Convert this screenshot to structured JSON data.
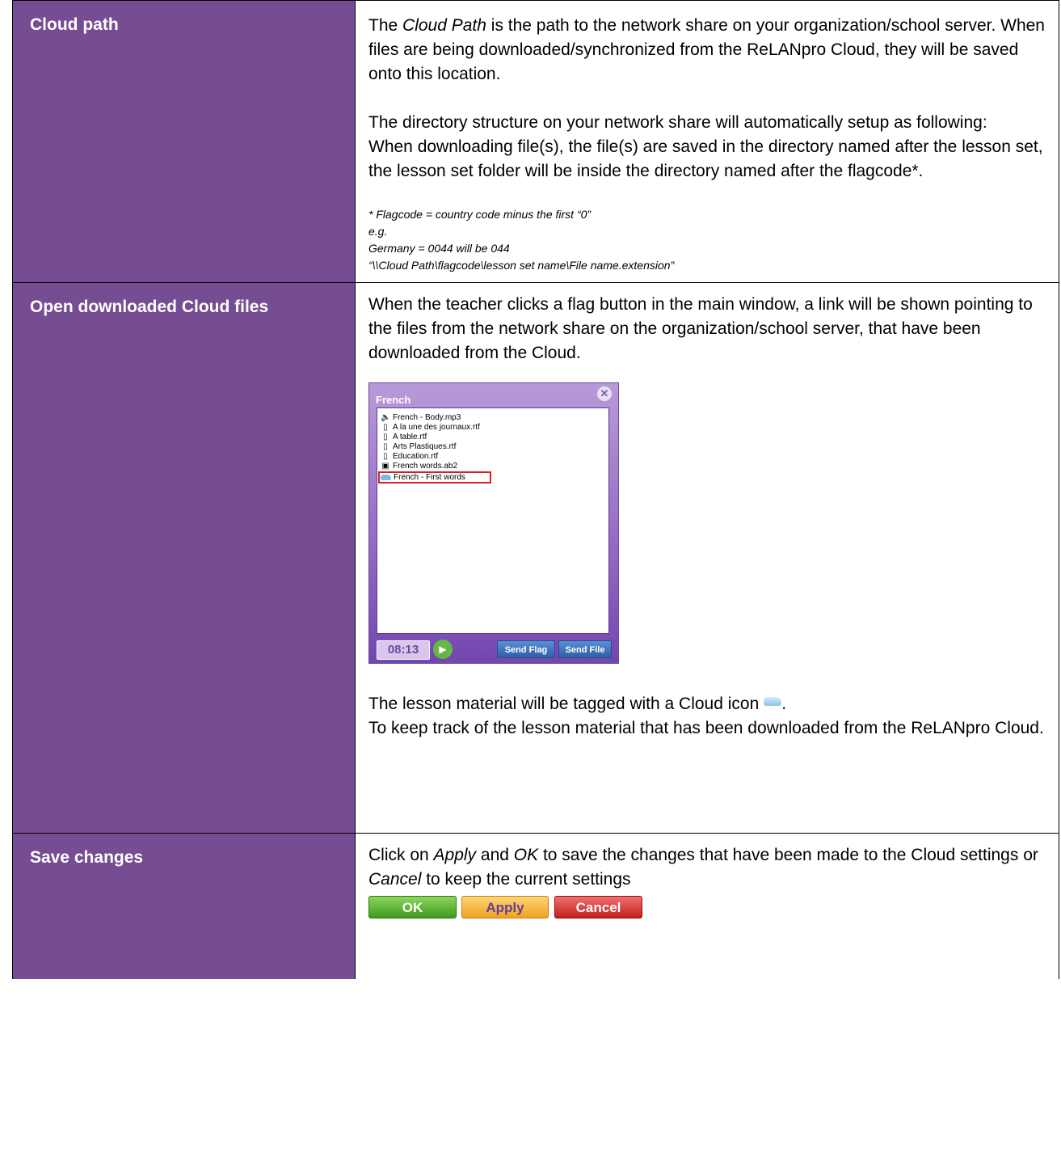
{
  "rows": [
    {
      "label": "Cloud path",
      "p1_pre": "The ",
      "p1_em": "Cloud Path",
      "p1_post": " is the path to the network share on your organization/school server. When files are being downloaded/synchronized from the ReLANpro Cloud, they will be saved onto this location.",
      "p2": "The directory structure on your network share will automatically setup as following:",
      "p3": "When downloading file(s), the file(s) are saved in the directory named after the lesson set, the lesson set folder will be inside the directory named after the flagcode*.",
      "note1": "* Flagcode = country code minus the first “0”",
      "note2": "e.g.",
      "note3": "Germany = 0044 will be 044",
      "note4": "“\\\\Cloud Path\\flagcode\\lesson set name\\File name.extension”"
    },
    {
      "label": "Open downloaded Cloud files",
      "p1": "When the teacher clicks a flag button in the main window, a link will be shown pointing to the files from the network share on the organization/school server, that have been downloaded from the Cloud.",
      "p2": "The lesson material will be tagged with a Cloud icon",
      "p2_end": ".",
      "p3": "To keep track of the lesson material that has been downloaded from the ReLANpro Cloud."
    },
    {
      "label": "Save changes",
      "p1_a": "Click on ",
      "p1_apply": "Apply",
      "p1_b": " and ",
      "p1_ok": "OK",
      "p1_c": " to save the changes that have been made to the Cloud settings or ",
      "p1_cancel": "Cancel",
      "p1_d": " to keep the current settings",
      "ok_label": "OK",
      "apply_label": "Apply",
      "cancel_label": "Cancel"
    }
  ],
  "flag_window": {
    "title": "French",
    "close_glyph": "✕",
    "files": [
      {
        "name": "French - Body.mp3",
        "icon": "speaker-icon"
      },
      {
        "name": "A la une des journaux.rtf",
        "icon": "document-icon"
      },
      {
        "name": "A table.rtf",
        "icon": "document-icon"
      },
      {
        "name": "Arts Plastiques.rtf",
        "icon": "document-icon"
      },
      {
        "name": "Education.rtf",
        "icon": "document-icon"
      },
      {
        "name": "French words.ab2",
        "icon": "ab2-file-icon"
      },
      {
        "name": "French - First words",
        "icon": "cloud-icon",
        "highlighted": true
      }
    ],
    "timer": "08:13",
    "send_flag": "Send Flag",
    "send_file": "Send File"
  }
}
